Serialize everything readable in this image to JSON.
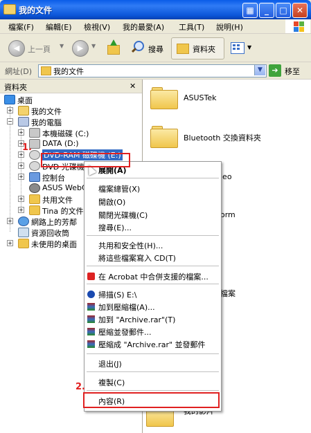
{
  "window": {
    "title": "我的文件"
  },
  "menubar": {
    "items": [
      "檔案(F)",
      "編輯(E)",
      "檢視(V)",
      "我的最愛(A)",
      "工具(T)",
      "說明(H)"
    ]
  },
  "toolbar": {
    "back": "上一頁",
    "search": "搜尋",
    "folders": "資料夾"
  },
  "address": {
    "label": "網址(D)",
    "value": "我的文件",
    "go": "移至"
  },
  "leftpane": {
    "header": "資料夾",
    "tree": [
      "桌面",
      "我的文件",
      "我的電腦",
      "本機磁碟 (C:)",
      "DATA (D:)",
      "DVD-RAM 磁碟機 (E:)",
      "DVD 光碟機",
      "控制台",
      "ASUS WebC",
      "共用文件",
      "Tina 的文件",
      "網路上的芳鄰",
      "資源回收筒",
      "未使用的桌面"
    ]
  },
  "rightpane": {
    "folders": [
      "ASUSTek",
      "Bluetooth 交換資料夾"
    ],
    "partial_labels": [
      "leo",
      "orm",
      "檔案",
      "我的影片"
    ]
  },
  "context_menu": {
    "items": [
      "展開(A)",
      "檔案總管(X)",
      "開啟(O)",
      "關閉光碟機(C)",
      "搜尋(E)...",
      "共用和安全性(H)...",
      "將這些檔案寫入 CD(T)",
      "在 Acrobat 中合併支援的檔案...",
      "掃描(S) E:\\",
      "加到壓縮檔(A)...",
      "加到 \"Archive.rar\"(T)",
      "壓縮並發郵件...",
      "壓縮成 \"Archive.rar\" 並發郵件",
      "退出(J)",
      "複製(C)",
      "內容(R)"
    ]
  },
  "annotations": {
    "step1": "1.",
    "step2": "2."
  },
  "colors": {
    "titlebar": "#0a5ce8",
    "selection": "#316ac5",
    "annotation_red": "#e02020",
    "folder_yellow": "#f0c64c"
  }
}
